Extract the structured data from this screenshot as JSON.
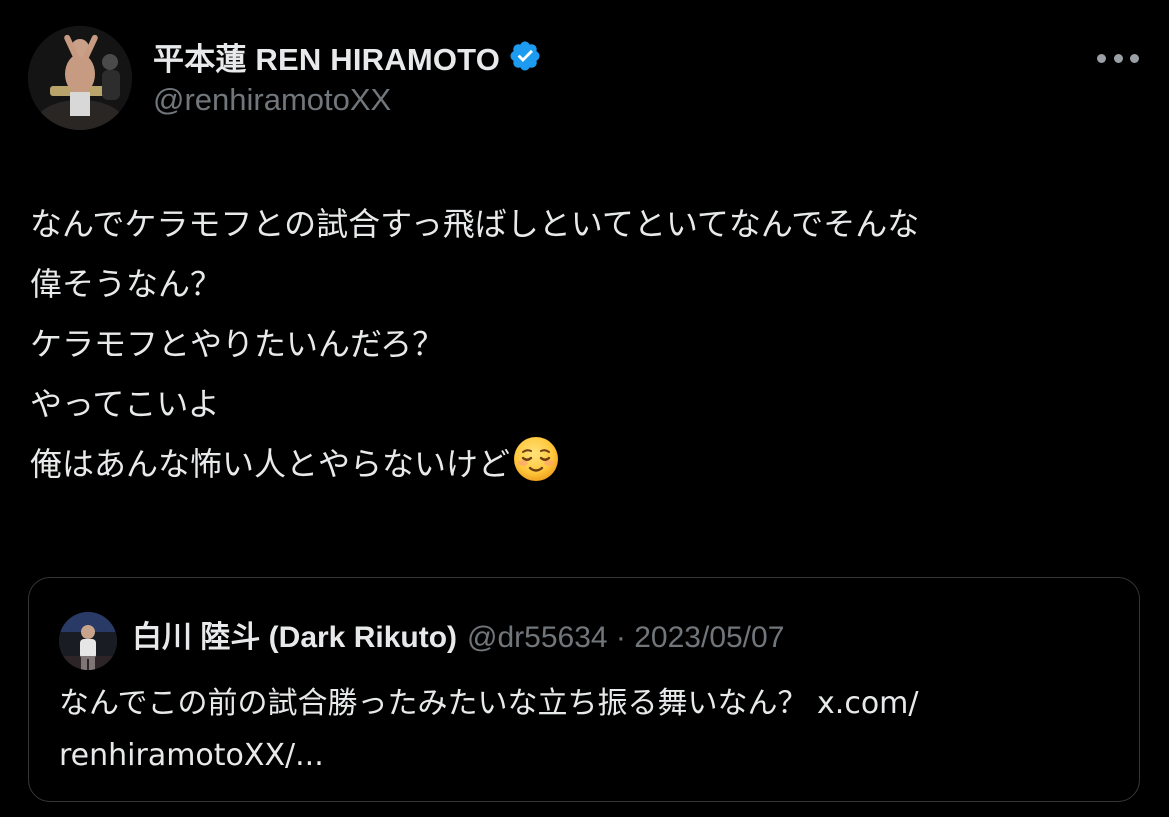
{
  "tweet": {
    "author": {
      "display_name": "平本蓮 REN HIRAMOTO",
      "handle": "@renhiramotoXX",
      "verified": true,
      "verified_color": "#1d9bf0"
    },
    "menu_icon": "more-dots-icon",
    "lines": [
      "なんでケラモフとの試合すっ飛ばしといてといてなんでそんな",
      "偉そうなん？",
      "ケラモフとやりたいんだろ？",
      "やってこいよ",
      "俺はあんな怖い人とやらないけど"
    ],
    "trailing_emoji": "relieved-face-emoji"
  },
  "quote": {
    "display_name": "白川 陸斗 (Dark Rikuto)",
    "meta": "@dr55634 · 2023/05/07",
    "lines": [
      "なんでこの前の試合勝ったみたいな立ち振る舞いなん？ x.com/",
      "renhiramotoXX/..."
    ]
  },
  "colors": {
    "background": "#000000",
    "primary_text": "#e7e9ea",
    "secondary_text": "#71767b",
    "border": "#333639"
  }
}
